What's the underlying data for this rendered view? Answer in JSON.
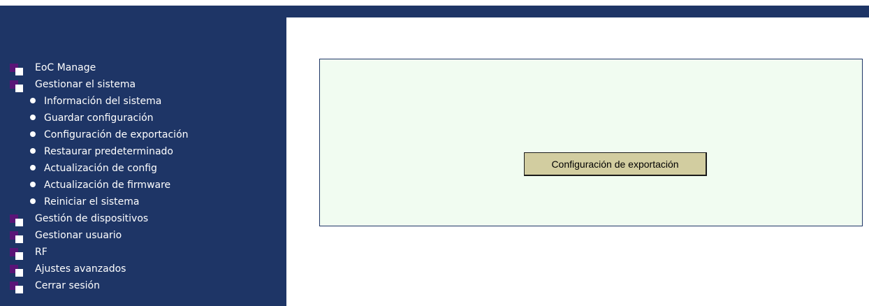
{
  "colors": {
    "sidebar_bg": "#1e3566",
    "folder_icon_back": "#5a1577",
    "panel_bg": "#f1fcf1",
    "button_bg": "#d2cda0"
  },
  "sidebar": {
    "items": [
      {
        "label": "EoC Manage",
        "icon": "folder-icon"
      },
      {
        "label": "Gestionar el sistema",
        "icon": "folder-icon",
        "subitems": [
          {
            "label": "Información del sistema",
            "icon": "bullet-icon"
          },
          {
            "label": "Guardar configuración",
            "icon": "bullet-icon"
          },
          {
            "label": "Configuración de exportación",
            "icon": "bullet-icon"
          },
          {
            "label": "Restaurar predeterminado",
            "icon": "bullet-icon"
          },
          {
            "label": "Actualización de config",
            "icon": "bullet-icon"
          },
          {
            "label": "Actualización de firmware",
            "icon": "bullet-icon"
          },
          {
            "label": "Reiniciar el sistema",
            "icon": "bullet-icon"
          }
        ]
      },
      {
        "label": "Gestión de dispositivos",
        "icon": "folder-icon"
      },
      {
        "label": "Gestionar usuario",
        "icon": "folder-icon"
      },
      {
        "label": "RF",
        "icon": "folder-icon"
      },
      {
        "label": "Ajustes avanzados",
        "icon": "folder-icon"
      },
      {
        "label": "Cerrar sesión",
        "icon": "folder-icon"
      }
    ]
  },
  "main": {
    "export_button_label": "Configuración de exportación"
  }
}
